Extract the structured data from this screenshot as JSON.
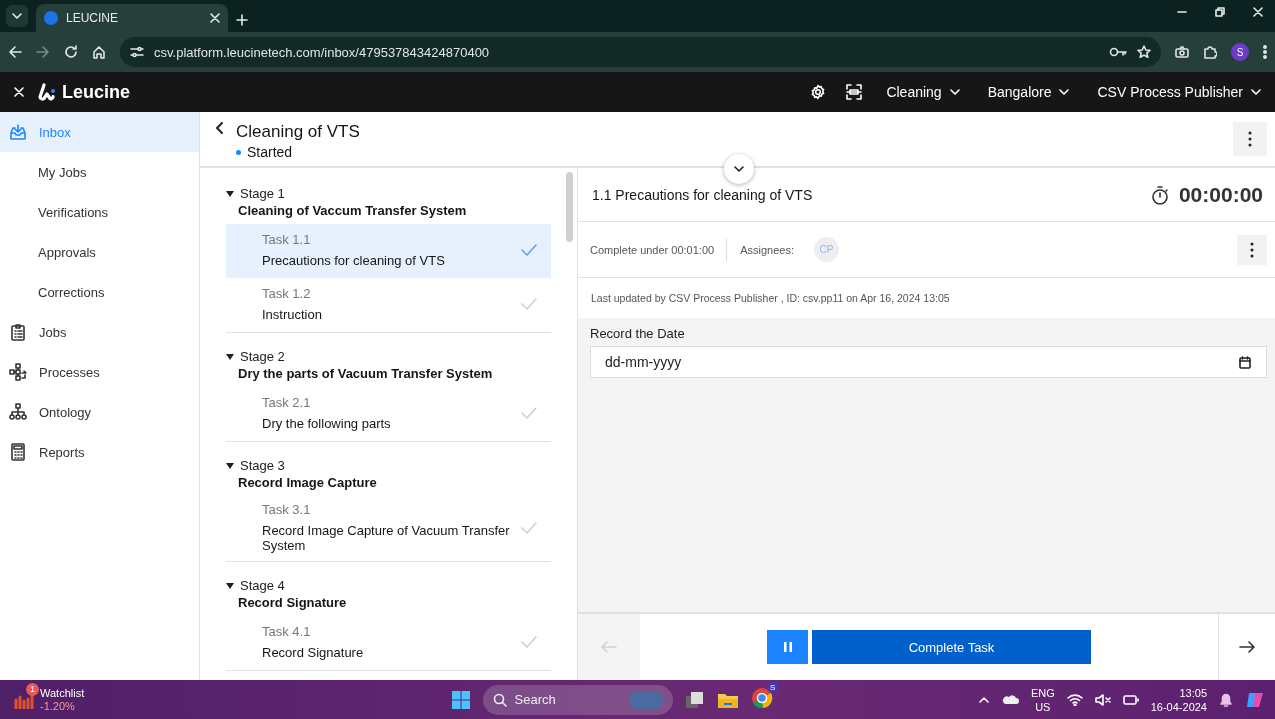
{
  "browser": {
    "tab_title": "LEUCINE",
    "url": "csv.platform.leucinetech.com/inbox/479537843424870400",
    "profile_initial": "S"
  },
  "app_header": {
    "logo": "Leucine",
    "dropdowns": [
      "Cleaning",
      "Bangalore",
      "CSV Process Publisher"
    ]
  },
  "sidebar": {
    "items": [
      {
        "label": "Inbox",
        "kind": "main",
        "selected": true
      },
      {
        "label": "My Jobs",
        "kind": "sub",
        "selected": false
      },
      {
        "label": "Verifications",
        "kind": "sub",
        "selected": false
      },
      {
        "label": "Approvals",
        "kind": "sub",
        "selected": false
      },
      {
        "label": "Corrections",
        "kind": "sub",
        "selected": false
      },
      {
        "label": "Jobs",
        "kind": "main",
        "selected": false
      },
      {
        "label": "Processes",
        "kind": "main",
        "selected": false
      },
      {
        "label": "Ontology",
        "kind": "main",
        "selected": false
      },
      {
        "label": "Reports",
        "kind": "main",
        "selected": false
      }
    ]
  },
  "job": {
    "title": "Cleaning of VTS",
    "status": "Started"
  },
  "stages": [
    {
      "label": "Stage 1",
      "name": "Cleaning of Vaccum Transfer System",
      "expanded": true,
      "tasks": [
        {
          "number": "Task 1.1",
          "name": "Precautions for cleaning of VTS",
          "selected": true
        },
        {
          "number": "Task 1.2",
          "name": "Instruction",
          "selected": false
        }
      ]
    },
    {
      "label": "Stage 2",
      "name": "Dry the parts of Vacuum Transfer System",
      "expanded": true,
      "tasks": [
        {
          "number": "Task 2.1",
          "name": "Dry the following parts",
          "selected": false
        }
      ]
    },
    {
      "label": "Stage 3",
      "name": "Record Image Capture",
      "expanded": true,
      "tasks": [
        {
          "number": "Task 3.1",
          "name": "Record Image Capture of Vacuum Transfer System",
          "selected": false
        }
      ]
    },
    {
      "label": "Stage 4",
      "name": "Record Signature",
      "expanded": true,
      "tasks": [
        {
          "number": "Task 4.1",
          "name": "Record Signature",
          "selected": false
        }
      ]
    }
  ],
  "task_detail": {
    "title": "1.1 Precautions for cleaning of VTS",
    "timer": "00:00:00",
    "complete_under": "Complete under 00:01:00",
    "assignees_label": "Assignees:",
    "assignees": [
      "CP"
    ],
    "last_updated": "Last updated by CSV Process Publisher , ID: csv.pp11 on Apr 16, 2024 13:05",
    "field": {
      "label": "Record the Date",
      "placeholder": "dd-mm-yyyy"
    },
    "complete_button": "Complete Task",
    "previous_disabled": true
  },
  "taskbar": {
    "chrome_badge": "S",
    "watchlist": {
      "title": "Watchlist",
      "change": "-1.20%",
      "badge": "1"
    },
    "search": {
      "placeholder": "Search"
    },
    "language": [
      "ENG",
      "US"
    ],
    "time": "13:05",
    "date": "16-04-2024"
  }
}
